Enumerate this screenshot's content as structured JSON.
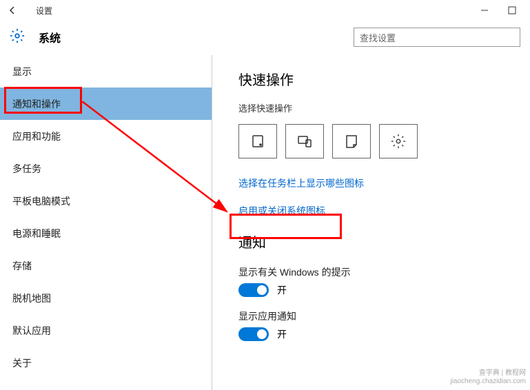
{
  "window": {
    "title": "设置",
    "category": "系统"
  },
  "search": {
    "placeholder": "查找设置"
  },
  "sidebar": {
    "items": [
      {
        "label": "显示"
      },
      {
        "label": "通知和操作"
      },
      {
        "label": "应用和功能"
      },
      {
        "label": "多任务"
      },
      {
        "label": "平板电脑模式"
      },
      {
        "label": "电源和睡眠"
      },
      {
        "label": "存储"
      },
      {
        "label": "脱机地图"
      },
      {
        "label": "默认应用"
      },
      {
        "label": "关于"
      }
    ],
    "selected_index": 1
  },
  "panel": {
    "quick_title": "快速操作",
    "quick_sub": "选择快速操作",
    "link_taskbar_icons": "选择在任务栏上显示哪些图标",
    "link_system_icons": "启用或关闭系统图标",
    "notif_title": "通知",
    "toggles": [
      {
        "label": "显示有关 Windows 的提示",
        "state": "开"
      },
      {
        "label": "显示应用通知",
        "state": "开"
      }
    ]
  },
  "watermark": {
    "line1": "查字典 | 教程网",
    "line2": "jiaocheng.chazidian.com"
  }
}
